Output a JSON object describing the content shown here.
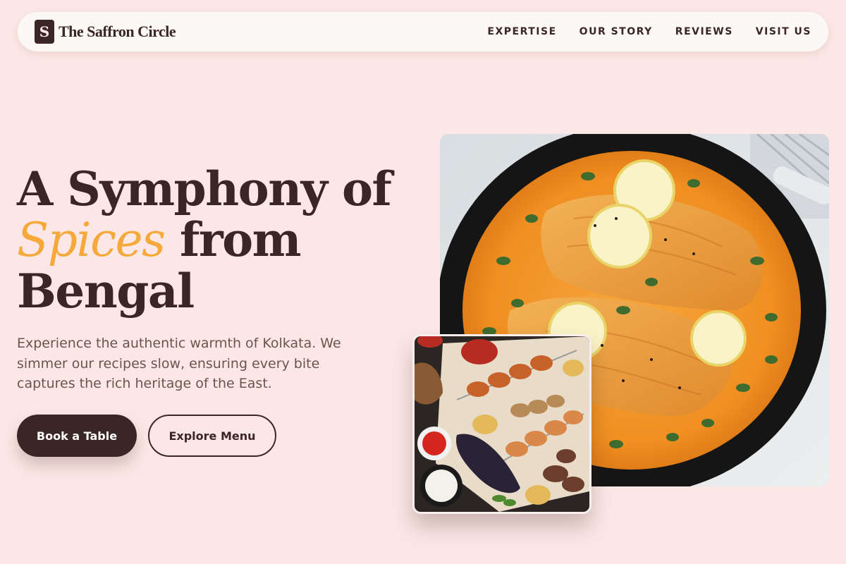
{
  "brand": {
    "mark": "S",
    "name": "The Saffron Circle"
  },
  "nav": {
    "links": [
      "EXPERTISE",
      "OUR STORY",
      "REVIEWS",
      "VISIT US"
    ]
  },
  "hero": {
    "headline_line1": "A Symphony of",
    "headline_accent": "Spices",
    "headline_line2_rest": " from",
    "headline_line3": "Bengal",
    "lede": "Experience the authentic warmth of Kolkata. We simmer our recipes slow, ensuring every bite captures the rich heritage of the East.",
    "primary_cta": "Book a Table",
    "secondary_cta": "Explore Menu"
  },
  "colors": {
    "background": "#fbe8e6",
    "brand_dark": "#3a2624",
    "accent": "#f6a93b",
    "muted_text": "#6b5450"
  },
  "images": {
    "main": "fish-curry-in-pan-photo",
    "inset": "grilled-kebab-platter-photo"
  }
}
